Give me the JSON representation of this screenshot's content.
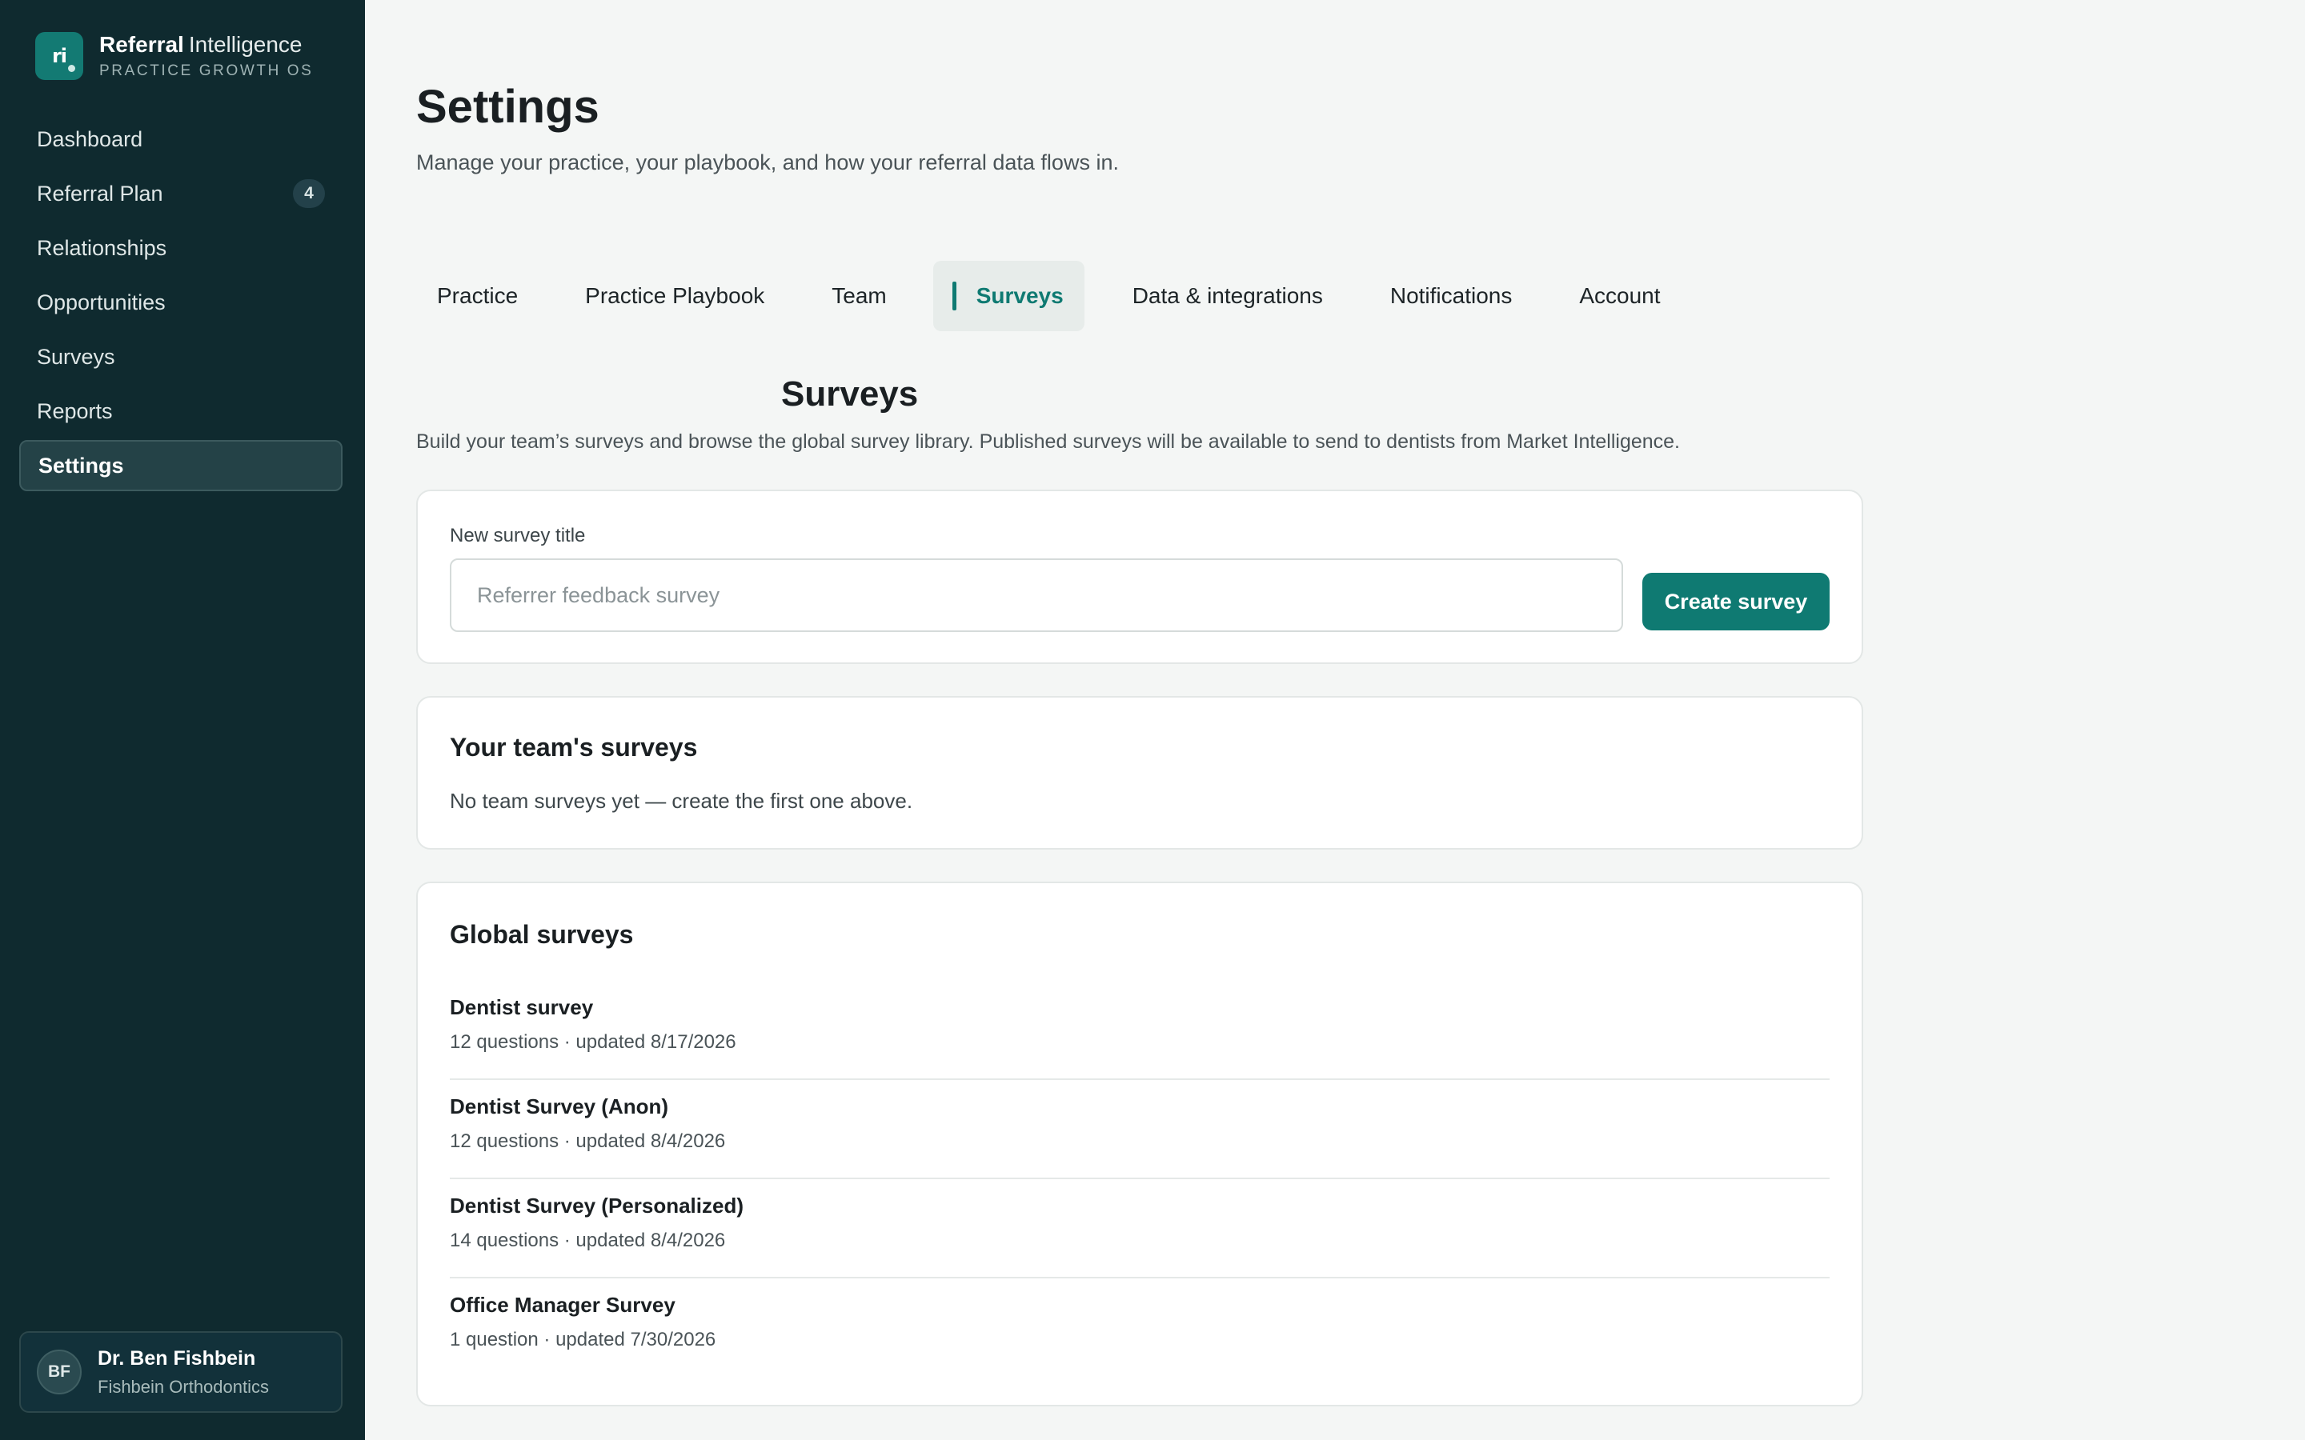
{
  "brand": {
    "logo_text": "ri",
    "name_strong": "Referral",
    "name_light": "Intelligence",
    "tagline": "PRACTICE GROWTH OS"
  },
  "sidebar": {
    "items": [
      {
        "label": "Dashboard"
      },
      {
        "label": "Referral Plan",
        "badge": "4"
      },
      {
        "label": "Relationships"
      },
      {
        "label": "Opportunities"
      },
      {
        "label": "Surveys"
      },
      {
        "label": "Reports"
      },
      {
        "label": "Settings",
        "active": true
      }
    ]
  },
  "user": {
    "initials": "BF",
    "name": "Dr. Ben Fishbein",
    "org": "Fishbein Orthodontics"
  },
  "page": {
    "title": "Settings",
    "subtitle": "Manage your practice, your playbook, and how your referral data flows in."
  },
  "tabs": [
    {
      "label": "Practice"
    },
    {
      "label": "Practice Playbook"
    },
    {
      "label": "Team"
    },
    {
      "label": "Surveys",
      "active": true
    },
    {
      "label": "Data & integrations"
    },
    {
      "label": "Notifications"
    },
    {
      "label": "Account"
    }
  ],
  "surveys": {
    "title": "Surveys",
    "description": "Build your team’s surveys and browse the global survey library. Published surveys will be available to send to dentists from Market Intelligence.",
    "create": {
      "label": "New survey title",
      "placeholder": "Referrer feedback survey",
      "value": "",
      "button_label": "Create survey"
    },
    "team": {
      "title": "Your team's surveys",
      "empty_text": "No team surveys yet — create the first one above."
    },
    "global": {
      "title": "Global surveys",
      "items": [
        {
          "name": "Dentist survey",
          "meta": "12 questions · updated 8/17/2026"
        },
        {
          "name": "Dentist Survey (Anon)",
          "meta": "12 questions · updated 8/4/2026"
        },
        {
          "name": "Dentist Survey (Personalized)",
          "meta": "14 questions · updated 8/4/2026"
        },
        {
          "name": "Office Manager Survey",
          "meta": "1 question · updated 7/30/2026"
        }
      ]
    }
  },
  "colors": {
    "accent": "#0f7a72",
    "sidebar_bg": "#0f2a2f",
    "page_bg": "#f4f6f5"
  }
}
